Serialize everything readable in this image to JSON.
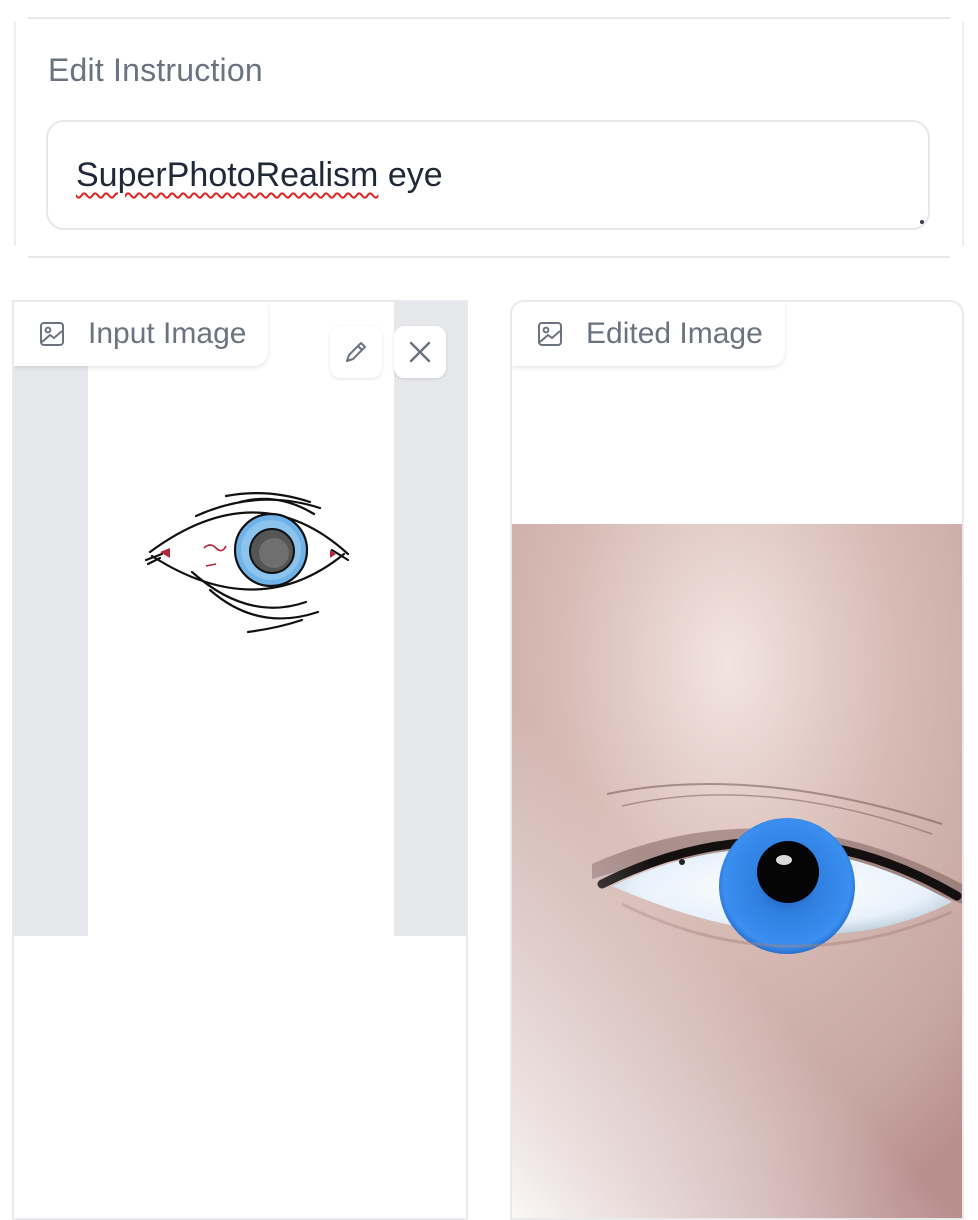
{
  "instruction": {
    "label": "Edit Instruction",
    "value_misspelled": "SuperPhotoRealism",
    "value_rest": " eye"
  },
  "input_panel": {
    "label": "Input Image",
    "icon": "image-icon",
    "edit_icon": "pencil-icon",
    "clear_icon": "close-icon"
  },
  "output_panel": {
    "label": "Edited Image",
    "icon": "image-icon"
  },
  "colors": {
    "border": "#e5e7eb",
    "label": "#6b7280",
    "text": "#1f2937",
    "spellcheck": "#e02424",
    "iris": "#2f7fe0"
  }
}
